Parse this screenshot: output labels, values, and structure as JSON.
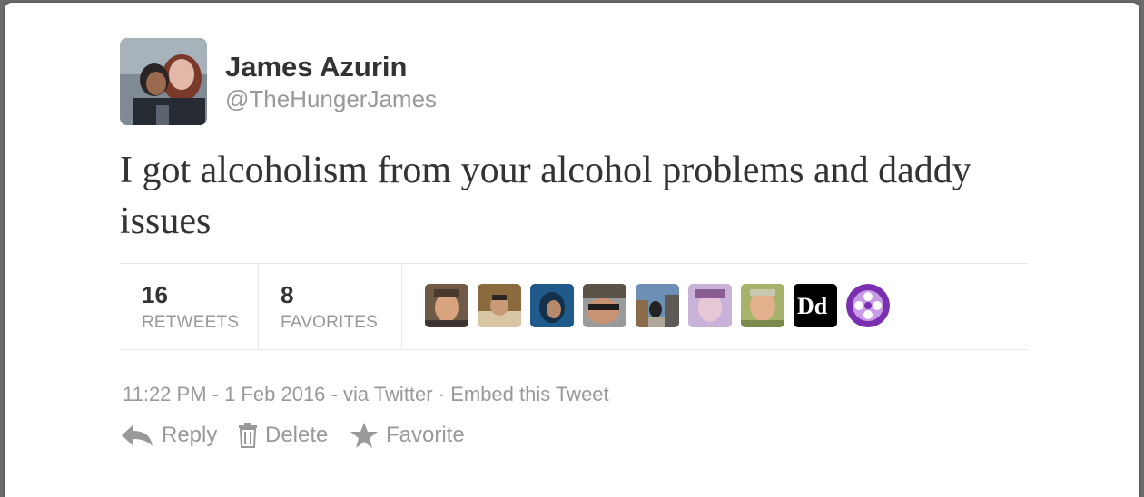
{
  "tweet": {
    "author_name": "James Azurin",
    "author_handle": "@TheHungerJames",
    "text": "I got alcoholism from your alcohol problems and daddy issues",
    "retweets_count": "16",
    "retweets_label": "RETWEETS",
    "favorites_count": "8",
    "favorites_label": "FAVORITES",
    "timestamp": "11:22 PM - 1 Feb 2016",
    "via": "via Twitter",
    "separator": "·",
    "embed_label": "Embed this Tweet"
  },
  "actions": {
    "reply_label": "Reply",
    "delete_label": "Delete",
    "favorite_label": "Favorite"
  },
  "favoriters": [
    {
      "icon": "avatar-man-smiling"
    },
    {
      "icon": "avatar-man-table"
    },
    {
      "icon": "avatar-blue-cartoon"
    },
    {
      "icon": "avatar-woman-sunglasses"
    },
    {
      "icon": "avatar-street"
    },
    {
      "icon": "avatar-purple-girl"
    },
    {
      "icon": "avatar-older-man"
    },
    {
      "icon": "avatar-dd-logo"
    },
    {
      "icon": "avatar-purple-flower"
    }
  ],
  "colors": {
    "text": "#333333",
    "muted": "#999999",
    "divider": "#e8e8e8"
  }
}
